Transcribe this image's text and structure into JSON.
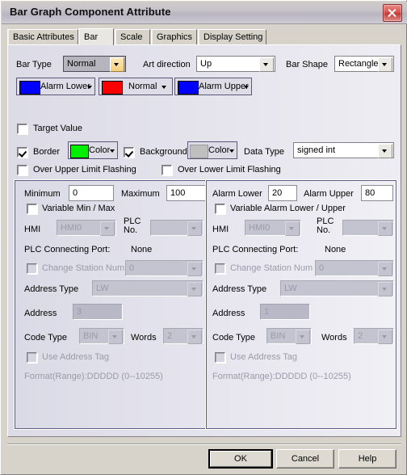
{
  "window": {
    "title": "Bar Graph Component Attribute",
    "close_icon": "close-icon"
  },
  "tabs": [
    {
      "label": "Basic Attributes",
      "active": false
    },
    {
      "label": "Bar",
      "active": true
    },
    {
      "label": "Scale",
      "active": false
    },
    {
      "label": "Graphics",
      "active": false
    },
    {
      "label": "Display Setting",
      "active": false
    }
  ],
  "bar_tab": {
    "bar_type": {
      "label": "Bar Type",
      "value": "Normal"
    },
    "art_direction": {
      "label": "Art direction",
      "value": "Up"
    },
    "bar_shape": {
      "label": "Bar Shape",
      "value": "Rectangle"
    },
    "color_buttons": [
      {
        "label": "Alarm Lower",
        "color": "#0000ff"
      },
      {
        "label": "Normal",
        "color": "#ff0000"
      },
      {
        "label": "Alarm Upper",
        "color": "#0000ff"
      }
    ],
    "target_value": {
      "label": "Target Value",
      "checked": false
    },
    "border": {
      "label": "Border",
      "checked": true,
      "color_label": "Color",
      "color": "#00ef00"
    },
    "background": {
      "label": "Background",
      "checked": true,
      "color_label": "Color",
      "color": "#bfbfbf"
    },
    "data_type": {
      "label": "Data Type",
      "value": "signed int"
    },
    "over_upper_limit_flashing": {
      "label": "Over Upper Limit Flashing",
      "checked": false
    },
    "over_lower_limit_flashing": {
      "label": "Over Lower Limit Flashing",
      "checked": false
    }
  },
  "left_group": {
    "minimum_label": "Minimum",
    "minimum_value": "0",
    "maximum_label": "Maximum",
    "maximum_value": "100",
    "variable_checkbox": {
      "label": "Variable Min / Max",
      "checked": false
    },
    "hmi_label": "HMI",
    "hmi_value": "HMI0",
    "plc_no_label": "PLC No.",
    "plc_no_value": "",
    "plc_port_label": "PLC Connecting Port:",
    "plc_port_value": "None",
    "change_station": {
      "label": "Change Station Num",
      "checked": false,
      "value": "0"
    },
    "address_type_label": "Address Type",
    "address_type_value": "LW",
    "address_label": "Address",
    "address_value": "3",
    "code_type_label": "Code Type",
    "code_type_value": "BIN",
    "words_label": "Words",
    "words_value": "2",
    "use_address_tag": {
      "label": "Use Address Tag",
      "checked": false
    },
    "format_text": "Format(Range):DDDDD (0--10255)"
  },
  "right_group": {
    "alarm_lower_label": "Alarm Lower",
    "alarm_lower_value": "20",
    "alarm_upper_label": "Alarm Upper",
    "alarm_upper_value": "80",
    "variable_checkbox": {
      "label": "Variable Alarm Lower / Upper",
      "checked": false
    },
    "hmi_label": "HMI",
    "hmi_value": "HMI0",
    "plc_no_label": "PLC No.",
    "plc_no_value": "",
    "plc_port_label": "PLC Connecting Port:",
    "plc_port_value": "None",
    "change_station": {
      "label": "Change Station Num",
      "checked": false,
      "value": "0"
    },
    "address_type_label": "Address Type",
    "address_type_value": "LW",
    "address_label": "Address",
    "address_value": "1",
    "code_type_label": "Code Type",
    "code_type_value": "BIN",
    "words_label": "Words",
    "words_value": "2",
    "use_address_tag": {
      "label": "Use Address Tag",
      "checked": false
    },
    "format_text": "Format(Range):DDDDD (0--10255)"
  },
  "footer": {
    "ok": "OK",
    "cancel": "Cancel",
    "help": "Help"
  }
}
